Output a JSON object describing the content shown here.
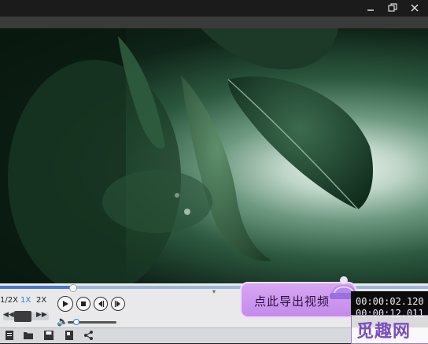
{
  "window": {
    "minimize_icon": "minimize-icon",
    "restore_icon": "restore-icon",
    "close_icon": "close-icon"
  },
  "playback": {
    "progress": 0.17,
    "speeds": [
      "1/2X",
      "1X",
      "2X"
    ],
    "active_speed": "1X",
    "volume": 0.12
  },
  "promo": {
    "label": "点此导出视频"
  },
  "time": {
    "current": "00:00:02.120",
    "total": "00:00:12.011"
  },
  "watermark": {
    "text": "觅趣网"
  },
  "colors": {
    "accent": "#2d7be0",
    "promo_bg": "#c48aea",
    "watermark": "#7a4fc0"
  }
}
